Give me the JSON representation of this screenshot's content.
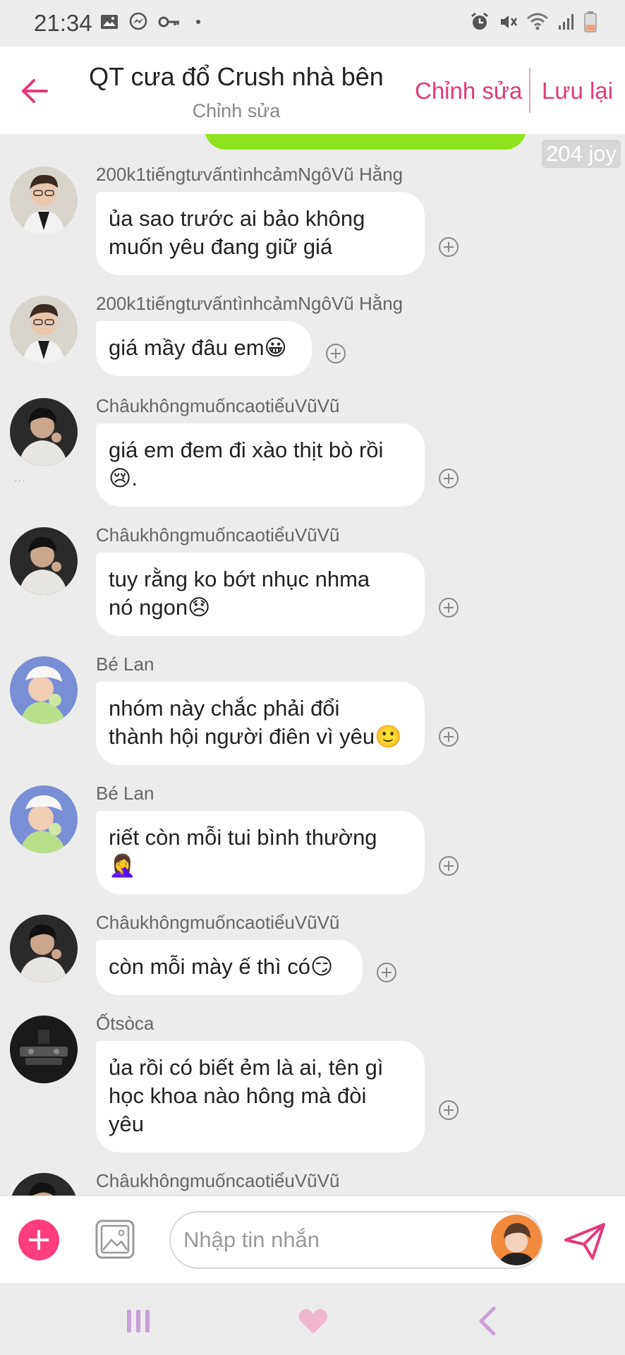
{
  "status_bar": {
    "time": "21:34"
  },
  "header": {
    "title": "QT cưa đổ Crush nhà bên",
    "subtitle": "Chỉnh sửa",
    "edit_label": "Chỉnh sửa",
    "save_label": "Lưu lại"
  },
  "chat": {
    "joy_badge": "204 joy",
    "messages": [
      {
        "sender": "200k1tiếngtưvấntìnhcảmNgôVũ Hằng",
        "lines": [
          "ủa sao trước ai bảo không",
          "muốn yêu đang giữ giá"
        ]
      },
      {
        "sender": "200k1tiếngtưvấntìnhcảmNgôVũ Hằng",
        "lines": [
          "giá mầy đâu em😀"
        ]
      },
      {
        "sender": "ChâukhôngmuốncaotiểuVũVũ",
        "lines": [
          "giá em đem đi xào thịt bò rồi",
          "😢."
        ]
      },
      {
        "sender": "ChâukhôngmuốncaotiểuVũVũ",
        "lines": [
          "tuy rằng ko bớt nhục nhma",
          "nó ngon😞"
        ]
      },
      {
        "sender": "Bé Lan",
        "lines": [
          "nhóm này chắc phải đổi",
          "thành hội người điên vì yêu🙂"
        ]
      },
      {
        "sender": "Bé Lan",
        "lines": [
          "riết còn mỗi tui bình thường",
          "🤦‍♀️"
        ]
      },
      {
        "sender": "ChâukhôngmuốncaotiểuVũVũ",
        "lines": [
          "còn mỗi mày ế thì có😏"
        ]
      },
      {
        "sender": "Ốtsòca",
        "lines": [
          "ủa rồi có biết ẻm là ai, tên gì",
          "học khoa nào hông mà đòi",
          "yêu"
        ]
      },
      {
        "sender": "ChâukhôngmuốncaotiểuVũVũ",
        "lines": []
      }
    ]
  },
  "composer": {
    "placeholder": "Nhập tin nhắn"
  },
  "colors": {
    "accent": "#e23a7c",
    "add_button": "#ff3d7f",
    "green_bubble": "#8fe31c",
    "background": "#ececec"
  },
  "icons": {
    "status_left": [
      "image-icon",
      "messenger-icon",
      "key-icon"
    ],
    "status_right": [
      "alarm-icon",
      "vibrate-icon",
      "wifi-icon",
      "signal-icon",
      "battery-icon"
    ],
    "nav": [
      "recent-apps-icon",
      "home-heart-icon",
      "back-icon"
    ]
  }
}
